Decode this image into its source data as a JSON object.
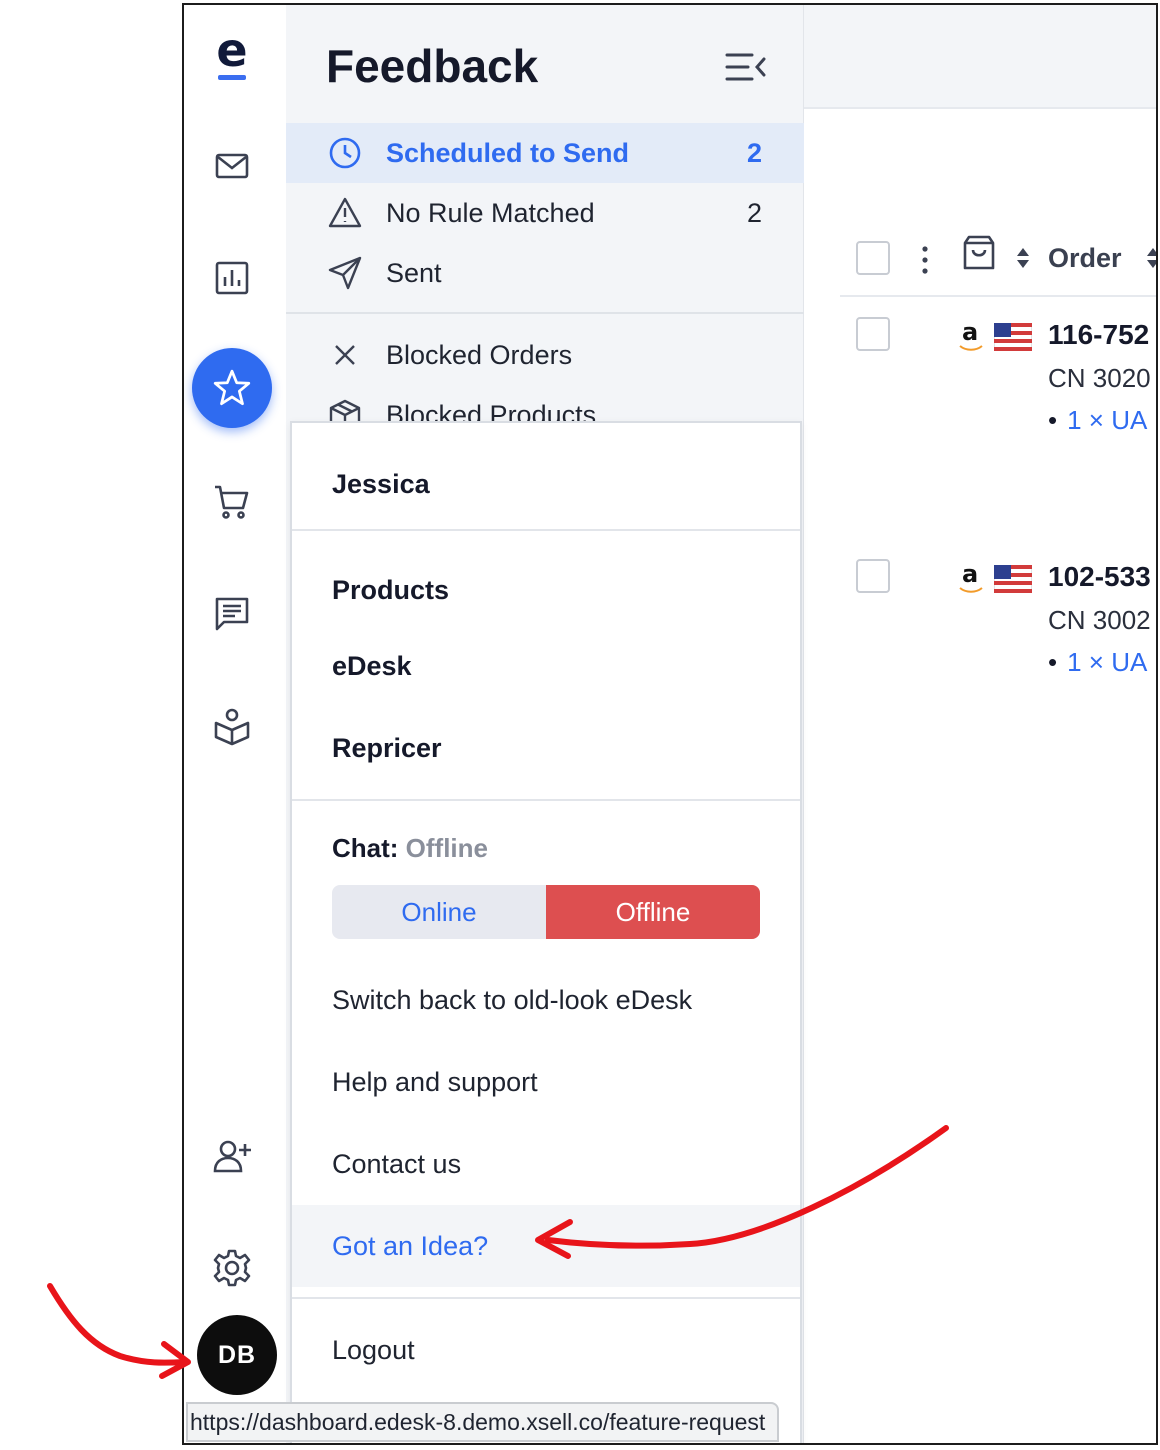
{
  "app": {
    "logo_letter": "e",
    "brand_color": "#2f6bf0",
    "status_url": "https://dashboard.edesk-8.demo.xsell.co/feature-request"
  },
  "rail": {
    "items": [
      {
        "name": "mail-icon"
      },
      {
        "name": "analytics-icon"
      },
      {
        "name": "star-icon",
        "active": true
      },
      {
        "name": "cart-icon"
      },
      {
        "name": "message-icon"
      },
      {
        "name": "learning-icon"
      },
      {
        "name": "add-user-icon"
      },
      {
        "name": "gear-icon"
      }
    ],
    "avatar_initials": "DB"
  },
  "panel": {
    "title": "Feedback",
    "folders": [
      {
        "label": "Scheduled to Send",
        "count": "2",
        "icon": "clock-icon",
        "active": true
      },
      {
        "label": "No Rule Matched",
        "count": "2",
        "icon": "warning-icon"
      },
      {
        "label": "Sent",
        "count": "",
        "icon": "send-icon"
      },
      {
        "label": "Blocked Orders",
        "count": "",
        "icon": "close-icon"
      },
      {
        "label": "Blocked Products",
        "count": "",
        "icon": "box-icon"
      }
    ]
  },
  "table": {
    "column_order": "Order",
    "rows": [
      {
        "order_id": "116-752",
        "cn": "CN 3020",
        "item": "1 × UA"
      },
      {
        "order_id": "102-533",
        "cn": "CN 3002",
        "item": "1 × UA"
      }
    ]
  },
  "menu": {
    "user_name": "Jessica",
    "products_heading": "Products",
    "product_links": [
      "eDesk",
      "Repricer"
    ],
    "chat_label": "Chat:",
    "chat_status": "Offline",
    "toggle_online": "Online",
    "toggle_offline": "Offline",
    "switch_back": "Switch back to old-look eDesk",
    "help": "Help and support",
    "contact": "Contact us",
    "idea": "Got an Idea?",
    "logout": "Logout"
  }
}
